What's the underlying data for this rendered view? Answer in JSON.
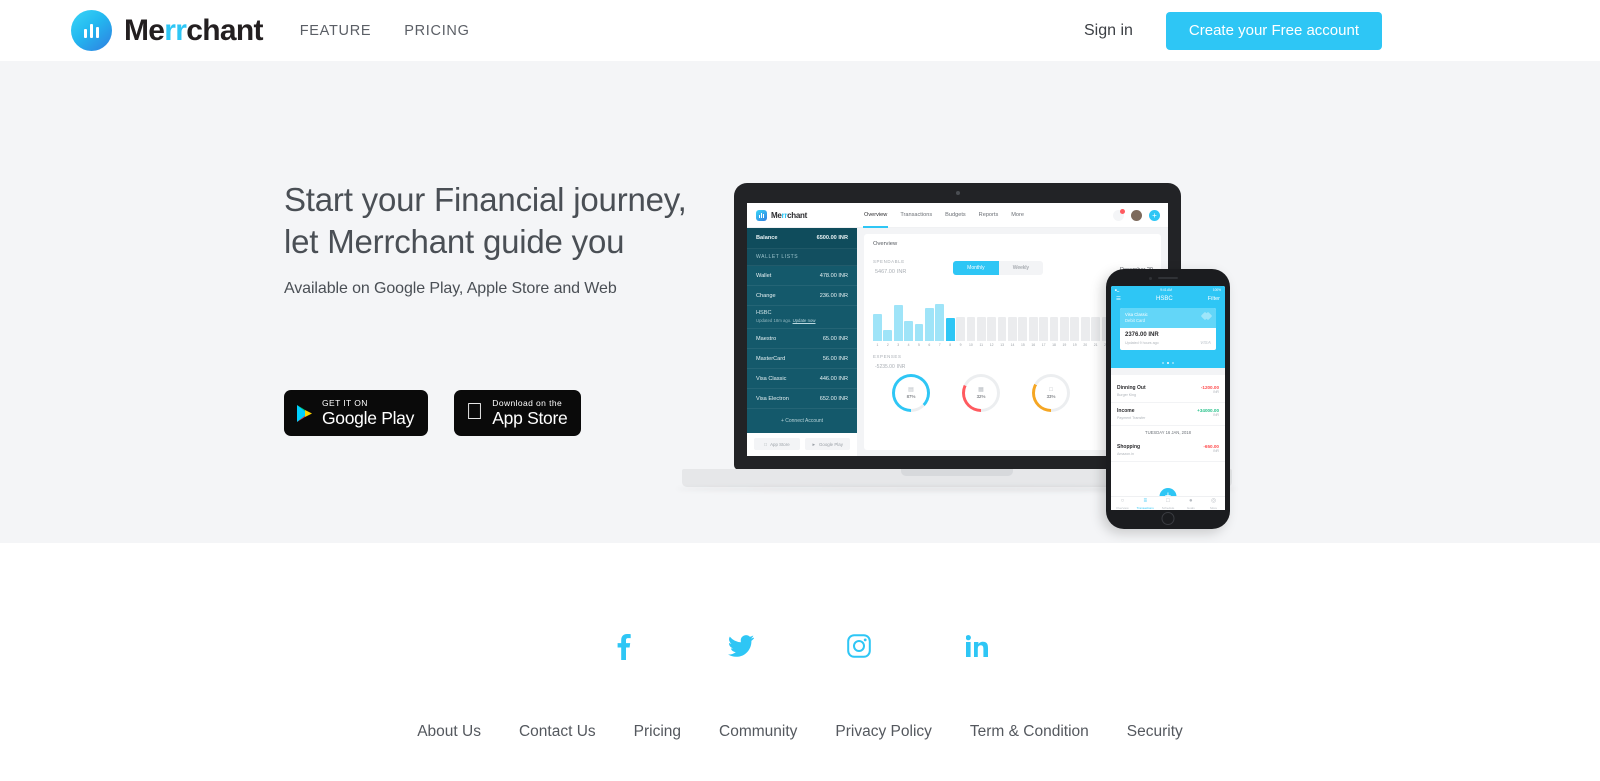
{
  "brand": {
    "name_prefix": "Me",
    "name_accent": "rr",
    "name_suffix": "chant",
    "logo_icon": "bar-chart-logo-icon"
  },
  "header": {
    "nav": [
      {
        "label": "FEATURE"
      },
      {
        "label": "PRICING"
      }
    ],
    "signin_label": "Sign in",
    "cta_label": "Create your Free account",
    "cta_color": "#2ec6f5"
  },
  "hero": {
    "title_line1": "Start your Financial journey,",
    "title_line2": "let Merrchant guide you",
    "subtitle": "Available on Google Play, Apple Store and Web",
    "background": "#f4f5f7",
    "badges": [
      {
        "icon": "google-play-icon",
        "small": "GET IT ON",
        "large": "Google Play"
      },
      {
        "icon": "apple-icon",
        "small": "Download on the",
        "large": "App Store"
      }
    ]
  },
  "mockup": {
    "laptop": {
      "app_brand_prefix": "Me",
      "app_brand_accent": "rr",
      "app_brand_suffix": "chant",
      "tabs": [
        {
          "label": "Overview",
          "active": true
        },
        {
          "label": "Transactions",
          "active": false
        },
        {
          "label": "Budgets",
          "active": false
        },
        {
          "label": "Reports",
          "active": false
        },
        {
          "label": "More",
          "active": false
        }
      ],
      "top_icons": [
        "bell-icon",
        "avatar-icon",
        "add-icon"
      ],
      "sidebar": {
        "balance_label": "Balance",
        "balance_value": "6500.00 INR",
        "section_label": "WALLET LISTS",
        "wallets": [
          {
            "name": "Wallet",
            "value": "478.00 INR"
          },
          {
            "name": "Change",
            "value": "236.00 INR"
          }
        ],
        "bank_name": "HSBC",
        "bank_updated": "Updated 18m ago.",
        "bank_update_link": "Update now",
        "cards": [
          {
            "name": "Maestro",
            "value": "65.00 INR"
          },
          {
            "name": "MasterCard",
            "value": "56.00 INR"
          },
          {
            "name": "Visa Classic",
            "value": "446.00 INR"
          },
          {
            "name": "Visa Electron",
            "value": "652.00 INR"
          }
        ],
        "connect_label": "+ Connect Account",
        "store_buttons": [
          {
            "icon": "apple-icon",
            "label": "App Store"
          },
          {
            "icon": "google-play-icon",
            "label": "Google Play"
          }
        ]
      },
      "overview": {
        "card_title": "Overview",
        "spendable_label": "SPENDABLE",
        "spendable_value": "5467.00",
        "spendable_currency": "INR",
        "toggle": [
          {
            "label": "Monthly",
            "active": true
          },
          {
            "label": "Weekly",
            "active": false
          }
        ],
        "date_label": "December 20",
        "expenses_label": "EXPENSES",
        "expenses_value": "-5235.00",
        "expenses_currency": "INR",
        "donuts": [
          {
            "pct": "87%",
            "value": 87,
            "color": "#2ec6f5",
            "icon": "bus-icon"
          },
          {
            "pct": "32%",
            "value": 32,
            "color": "#ff5a5f",
            "icon": "food-icon"
          },
          {
            "pct": "33%",
            "value": 33,
            "color": "#f5a623",
            "icon": "cup-icon"
          }
        ]
      }
    },
    "phone": {
      "status_left": "9:41 AM",
      "status_right": "100%",
      "menu_icon": "menu-icon",
      "title": "HSBC",
      "filter_label": "Filter",
      "card": {
        "type_line1": "Visa Classic",
        "type_line2": "Debit Card",
        "amount": "2376.00 INR",
        "updated": "Updated 9 hours ago",
        "network": "VISA"
      },
      "transactions": [
        {
          "name": "Dinning Out",
          "sub": "Burger King",
          "amount": "-1200.00",
          "currency": "INR",
          "sign": "neg"
        },
        {
          "name": "Income",
          "sub": "Payment Transfer",
          "amount": "+34000.00",
          "currency": "INR",
          "sign": "pos"
        }
      ],
      "day_divider": "TUESDAY  16 JAN, 2018",
      "transactions2": [
        {
          "name": "Shopping",
          "sub": "Amazon.in",
          "amount": "-650.00",
          "currency": "INR",
          "sign": "neg"
        }
      ],
      "fab_icon": "add-icon",
      "nav": [
        {
          "label": "Overview",
          "glyph": "○",
          "active": false
        },
        {
          "label": "Transactions",
          "glyph": "≡",
          "active": true
        },
        {
          "label": "Schedule",
          "glyph": "□",
          "active": false
        },
        {
          "label": "Goals",
          "glyph": "●",
          "active": false
        },
        {
          "label": "More",
          "glyph": "◎",
          "active": false
        }
      ]
    }
  },
  "footer": {
    "socials": [
      {
        "name": "facebook-icon",
        "label": "f"
      },
      {
        "name": "twitter-icon",
        "label": "t"
      },
      {
        "name": "instagram-icon",
        "label": "i"
      },
      {
        "name": "linkedin-icon",
        "label": "in"
      }
    ],
    "links": [
      {
        "label": "About Us"
      },
      {
        "label": "Contact Us"
      },
      {
        "label": "Pricing"
      },
      {
        "label": "Community"
      },
      {
        "label": "Privacy Policy"
      },
      {
        "label": "Term & Condition"
      },
      {
        "label": "Security"
      }
    ],
    "accent_color": "#2ec6f5"
  },
  "chart_data": {
    "type": "bar",
    "title": "Spendable monthly",
    "categories": [
      "1",
      "2",
      "3",
      "4",
      "5",
      "6",
      "7",
      "8",
      "9",
      "10",
      "11",
      "12",
      "13",
      "14",
      "15",
      "16",
      "17",
      "18",
      "19",
      "19",
      "20",
      "21",
      "22",
      "23",
      "24",
      "25",
      "26"
    ],
    "values": [
      22,
      9,
      30,
      17,
      14,
      27,
      31,
      19,
      0,
      0,
      0,
      0,
      0,
      0,
      0,
      0,
      0,
      0,
      0,
      0,
      0,
      0,
      0,
      0,
      0,
      0,
      0
    ],
    "filled_count": 8,
    "active_index": 7,
    "xlabel": "",
    "ylabel": "",
    "ylim": [
      0,
      34
    ]
  }
}
